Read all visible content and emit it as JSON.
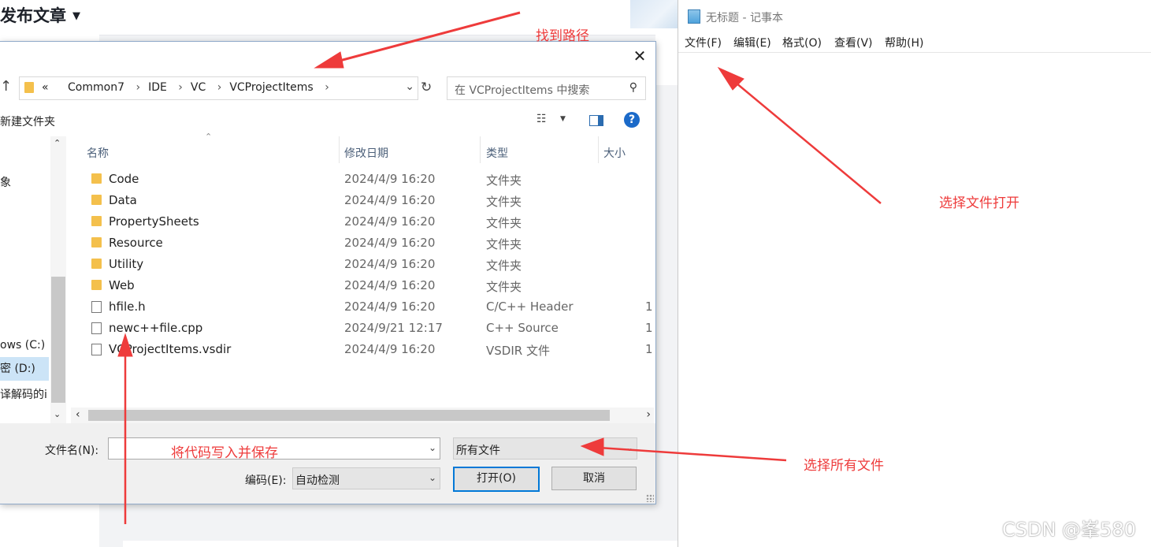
{
  "background": {
    "page_title": "发布文章"
  },
  "dialog": {
    "address": [
      "«",
      "Common7",
      "IDE",
      "VC",
      "VCProjectItems"
    ],
    "search_placeholder": "在 VCProjectItems 中搜索",
    "new_folder_label": "新建文件夹",
    "columns": [
      "名称",
      "修改日期",
      "类型",
      "大小"
    ],
    "nav_items": [
      {
        "label": "象",
        "selected": false
      },
      {
        "label": "ows (C:)",
        "selected": false
      },
      {
        "label": "密 (D:)",
        "selected": true
      },
      {
        "label": "译解码的i",
        "selected": false
      }
    ],
    "files": [
      {
        "name": "Code",
        "date": "2024/4/9 16:20",
        "type": "文件夹",
        "size": "",
        "kind": "folder"
      },
      {
        "name": "Data",
        "date": "2024/4/9 16:20",
        "type": "文件夹",
        "size": "",
        "kind": "folder"
      },
      {
        "name": "PropertySheets",
        "date": "2024/4/9 16:20",
        "type": "文件夹",
        "size": "",
        "kind": "folder"
      },
      {
        "name": "Resource",
        "date": "2024/4/9 16:20",
        "type": "文件夹",
        "size": "",
        "kind": "folder"
      },
      {
        "name": "Utility",
        "date": "2024/4/9 16:20",
        "type": "文件夹",
        "size": "",
        "kind": "folder"
      },
      {
        "name": "Web",
        "date": "2024/4/9 16:20",
        "type": "文件夹",
        "size": "",
        "kind": "folder"
      },
      {
        "name": "hfile.h",
        "date": "2024/4/9 16:20",
        "type": "C/C++ Header",
        "size": "1",
        "kind": "file"
      },
      {
        "name": "newc++file.cpp",
        "date": "2024/9/21 12:17",
        "type": "C++ Source",
        "size": "1",
        "kind": "file"
      },
      {
        "name": "VCProjectItems.vsdir",
        "date": "2024/4/9 16:20",
        "type": "VSDIR 文件",
        "size": "1",
        "kind": "file"
      }
    ],
    "filename_label": "文件名(N):",
    "filename_value": "",
    "filetype_value": "所有文件",
    "encoding_label": "编码(E):",
    "encoding_value": "自动检测",
    "open_button": "打开(O)",
    "cancel_button": "取消"
  },
  "notepad": {
    "title": "无标题 - 记事本",
    "menus": [
      "文件(F)",
      "编辑(E)",
      "格式(O)",
      "查看(V)",
      "帮助(H)"
    ]
  },
  "annotations": {
    "find_path": "找到路径",
    "choose_file_open": "选择文件打开",
    "choose_all_files": "选择所有文件",
    "write_and_save": "将代码写入并保存",
    "color": "#ee3b3b"
  },
  "watermark": "CSDN @峯580"
}
